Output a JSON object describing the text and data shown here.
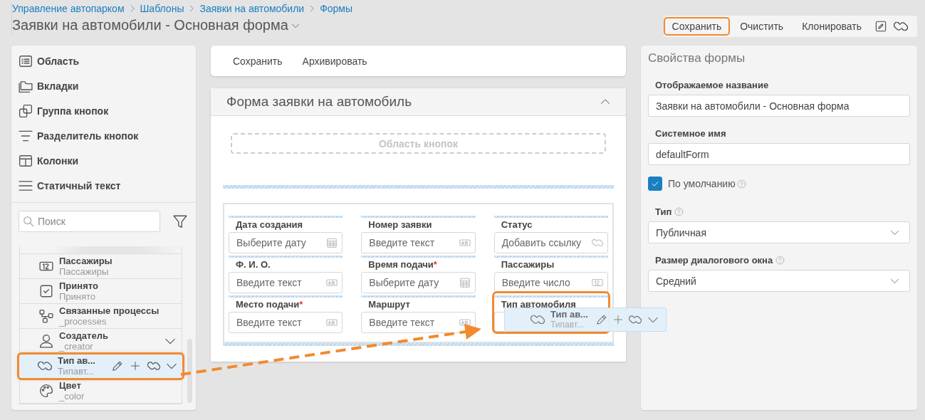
{
  "breadcrumbs": [
    {
      "label": "Управление автопарком"
    },
    {
      "label": "Шаблоны"
    },
    {
      "label": "Заявки на автомобили"
    },
    {
      "label": "Формы"
    }
  ],
  "page_title": "Заявки на автомобили - Основная форма",
  "toolbar": [
    {
      "label": "Сохранить",
      "highlighted": true
    },
    {
      "label": "Очистить",
      "highlighted": false
    },
    {
      "label": "Клонировать",
      "highlighted": false
    }
  ],
  "palette": [
    {
      "kind": "area",
      "label": "Область"
    },
    {
      "kind": "tabs",
      "label": "Вкладки"
    },
    {
      "kind": "button-group",
      "label": "Группа кнопок"
    },
    {
      "kind": "divider",
      "label": "Разделитель кнопок"
    },
    {
      "kind": "columns",
      "label": "Колонки"
    },
    {
      "kind": "static-text",
      "label": "Статичный текст"
    }
  ],
  "search": {
    "placeholder": "Поиск"
  },
  "fields": [
    {
      "kind": "number",
      "name": "Пассажиры",
      "system_name": "Пассажиры",
      "expandable": false,
      "selected": false
    },
    {
      "kind": "checkbox",
      "name": "Принято",
      "system_name": "Принято",
      "expandable": false,
      "selected": false
    },
    {
      "kind": "processes",
      "name": "Связанные процессы",
      "system_name": "_processes",
      "expandable": false,
      "selected": false
    },
    {
      "kind": "user",
      "name": "Создатель",
      "system_name": "_creator",
      "expandable": true,
      "selected": false
    },
    {
      "kind": "link",
      "name": "Тип ав...",
      "system_name": "Типавт...",
      "expandable": true,
      "selected": true
    },
    {
      "kind": "palette",
      "name": "Цвет",
      "system_name": "_color",
      "expandable": false,
      "selected": false
    }
  ],
  "form_toolbar": [
    {
      "label": "Сохранить"
    },
    {
      "label": "Архивировать"
    }
  ],
  "form": {
    "title": "Форма заявки на автомобиль",
    "expanded": true,
    "button_area": "Область кнопок",
    "columns": [
      [
        {
          "label": "Дата создания",
          "kind": "date",
          "placeholder": "Выберите дату",
          "drop_target": false
        },
        {
          "label": "Ф. И. О.",
          "kind": "text",
          "placeholder": "Введите текст",
          "drop_target": false
        },
        {
          "label": "Место подачи",
          "marker": "*",
          "kind": "text",
          "placeholder": "Введите текст",
          "drop_target": false
        }
      ],
      [
        {
          "label": "Номер заявки",
          "kind": "text",
          "placeholder": "Введите текст",
          "drop_target": false
        },
        {
          "label": "Время подачи",
          "marker": "*",
          "kind": "date",
          "placeholder": "Выберите дату",
          "drop_target": false
        },
        {
          "label": "Маршрут",
          "kind": "text",
          "placeholder": "Введите текст",
          "drop_target": false
        }
      ],
      [
        {
          "label": "Статус",
          "kind": "link",
          "placeholder": "Добавить ссылку",
          "drop_target": false
        },
        {
          "label": "Пассажиры",
          "kind": "number",
          "placeholder": "Введите число",
          "drop_target": false
        },
        {
          "label": "Тип автомобиля",
          "kind": "link",
          "drop_target": true
        }
      ]
    ]
  },
  "drag_ghost": {
    "kind": "link",
    "name": "Тип ав...",
    "system_name": "Типавт..."
  },
  "properties": {
    "title": "Свойства формы",
    "display_name": {
      "label": "Отображаемое название",
      "value": "Заявки на автомобили - Основная форма"
    },
    "system_name": {
      "label": "Системное имя",
      "value": "defaultForm"
    },
    "default": {
      "label": "По умолчанию",
      "checked": true
    },
    "type": {
      "label": "Тип",
      "value": "Публичная"
    },
    "dialog_size": {
      "label": "Размер диалогового окна",
      "value": "Средний"
    }
  }
}
